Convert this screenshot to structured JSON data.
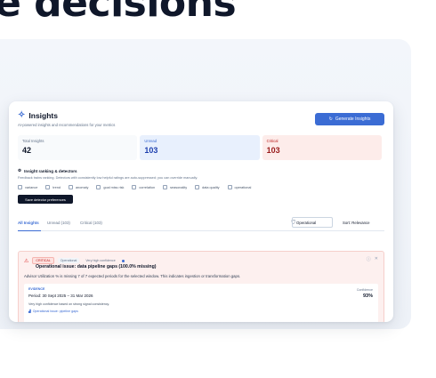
{
  "hero": {
    "title": "e decisions"
  },
  "header": {
    "title": "Insights",
    "subtitle": "AI-powered insights and recommendations for your metrics",
    "generate_button": "Generate Insights"
  },
  "stats": [
    {
      "label": "Total Insights",
      "value": "42"
    },
    {
      "label": "Unread",
      "value": "103"
    },
    {
      "label": "Critical",
      "value": "103"
    }
  ],
  "ranking": {
    "title": "Insight ranking & detectors",
    "description": "Feedback trains ranking. Detectors with consistently low helpful ratings are auto-suppressed; you can override manually.",
    "detectors": [
      "variance",
      "trend",
      "anomaly",
      "goal miss risk",
      "correlation",
      "seasonality",
      "data quality",
      "operational"
    ],
    "save_button": "Save detector preferences"
  },
  "tabs": [
    "All Insights",
    "Unread (103)",
    "Critical (103)"
  ],
  "filters": {
    "category": "Operational",
    "sort": "Sort: Relevance"
  },
  "insight": {
    "severity": "CRITICAL",
    "category": "Operational",
    "confidence_label": "Very high confidence",
    "title": "Operational issue: data pipeline gaps (100.0% missing)",
    "description": "Advisor Utilization % is missing 7 of 7 expected periods for the selected window. This indicates ingestion or transformation gaps.",
    "evidence_label": "EVIDENCE",
    "period": "Period: 30 Sept 2025 – 31 Mar 2026",
    "note": "Very high confidence based on strong signal consistency.",
    "tag": "Operational issue: pipeline gaps",
    "confidence_title": "Confidence",
    "confidence_value": "93%"
  },
  "colors": {
    "accent": "#3b6cd4",
    "critical": "#dc2626",
    "navy": "#0f172a"
  }
}
